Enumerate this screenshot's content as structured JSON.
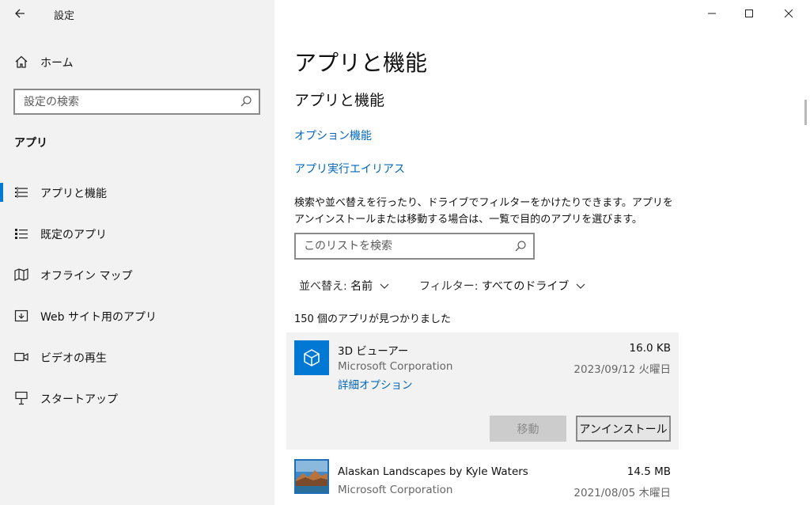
{
  "window": {
    "title": "設定"
  },
  "sidebar": {
    "home_label": "ホーム",
    "search_placeholder": "設定の検索",
    "section_label": "アプリ",
    "items": [
      {
        "label": "アプリと機能",
        "icon": "apps-features-icon",
        "selected": true
      },
      {
        "label": "既定のアプリ",
        "icon": "default-apps-icon",
        "selected": false
      },
      {
        "label": "オフライン マップ",
        "icon": "offline-maps-icon",
        "selected": false
      },
      {
        "label": "Web サイト用のアプリ",
        "icon": "apps-for-websites-icon",
        "selected": false
      },
      {
        "label": "ビデオの再生",
        "icon": "video-playback-icon",
        "selected": false
      },
      {
        "label": "スタートアップ",
        "icon": "startup-icon",
        "selected": false
      }
    ]
  },
  "main": {
    "page_title": "アプリと機能",
    "sub_title": "アプリと機能",
    "link_optional": "オプション機能",
    "link_alias": "アプリ実行エイリアス",
    "description": "検索や並べ替えを行ったり、ドライブでフィルターをかけたりできます。アプリをアンインストールまたは移動する場合は、一覧で目的のアプリを選びます。",
    "list_search_placeholder": "このリストを検索",
    "sort_key": "並べ替え:",
    "sort_value": "名前",
    "filter_key": "フィルター:",
    "filter_value": "すべてのドライブ",
    "count_text": "150 個のアプリが見つかりました",
    "apps": [
      {
        "name": "3D ビューアー",
        "publisher": "Microsoft Corporation",
        "size": "16.0 KB",
        "date": "2023/09/12 火曜日",
        "advanced": "詳細オプション",
        "move_label": "移動",
        "uninstall_label": "アンインストール",
        "expanded": true
      },
      {
        "name": "Alaskan Landscapes by Kyle Waters",
        "publisher": "Microsoft Corporation",
        "size": "14.5 MB",
        "date": "2021/08/05 木曜日",
        "expanded": false
      }
    ]
  },
  "colors": {
    "accent": "#0078d4",
    "link": "#0067c0",
    "sidebar_bg": "#f2f2f2"
  }
}
